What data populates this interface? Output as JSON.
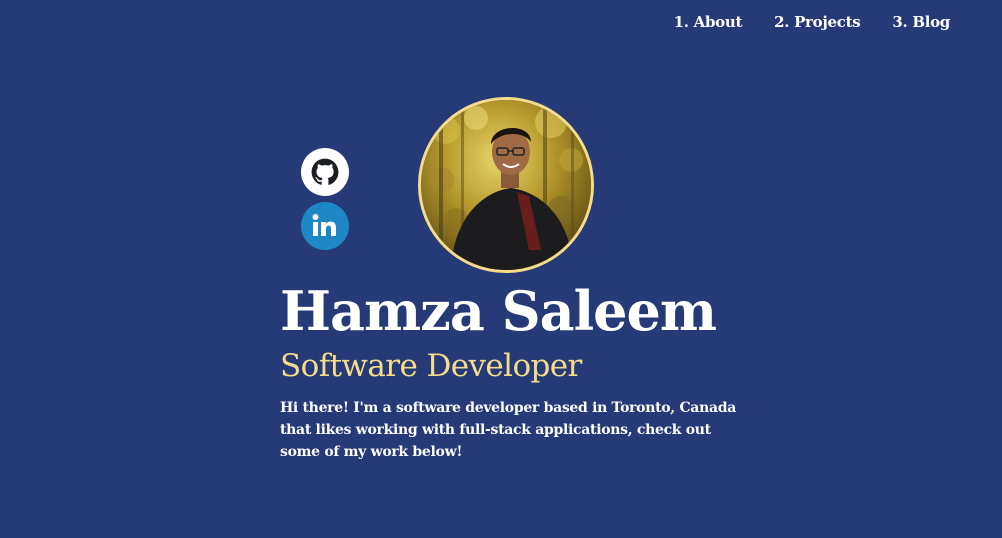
{
  "nav": {
    "items": [
      {
        "label": "1. About"
      },
      {
        "label": "2. Projects"
      },
      {
        "label": "3. Blog"
      }
    ]
  },
  "social": {
    "github_icon": "github-icon",
    "linkedin_icon": "linkedin-icon",
    "linkedin_color": "#1e88c7"
  },
  "hero": {
    "name": "Hamza Saleem",
    "role": "Software Developer",
    "bio": "Hi there! I'm a software developer based in Toronto, Canada that likes working with full-stack applications, check out some of my work below!"
  },
  "theme": {
    "background": "#273a78",
    "accent": "#f5dc8a",
    "text": "#ffffff"
  }
}
